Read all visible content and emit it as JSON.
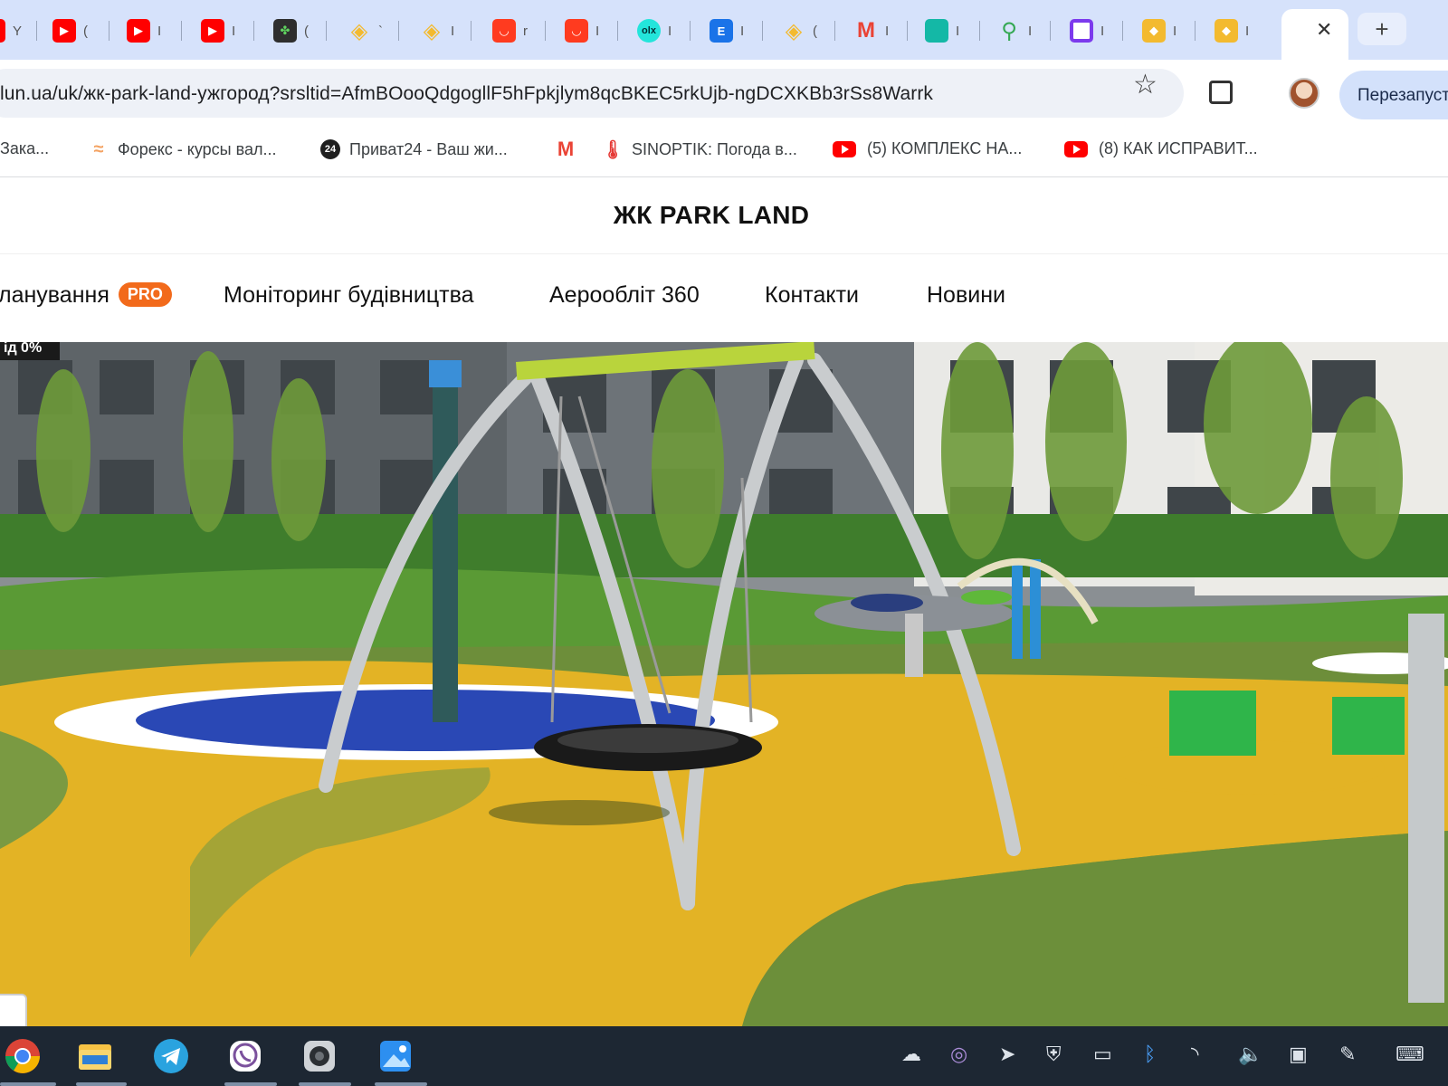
{
  "browser": {
    "tabs": [
      {
        "icon": "youtube-icon",
        "text": "Y",
        "color": "#ff0000"
      },
      {
        "icon": "youtube-icon",
        "text": "(",
        "color": "#ff0000"
      },
      {
        "icon": "youtube-icon",
        "text": "I",
        "color": "#ff0000"
      },
      {
        "icon": "youtube-icon",
        "text": "I",
        "color": "#ff0000"
      },
      {
        "icon": "clover-icon",
        "text": "(",
        "color": "#3a8f3a"
      },
      {
        "icon": "binance-icon",
        "text": "`",
        "color": "#f3ba2f"
      },
      {
        "icon": "binance-icon",
        "text": "I",
        "color": "#f3ba2f"
      },
      {
        "icon": "aliexpress-icon",
        "text": "r",
        "color": "#ff3b1f"
      },
      {
        "icon": "aliexpress-icon",
        "text": "I",
        "color": "#ff3b1f"
      },
      {
        "icon": "olx-icon",
        "text": "I",
        "color": "#002f34"
      },
      {
        "icon": "e-icon",
        "text": "I",
        "color": "#1a73e8"
      },
      {
        "icon": "binance-icon",
        "text": "(",
        "color": "#f3ba2f"
      },
      {
        "icon": "gmail-icon",
        "text": "I",
        "color": "#ea4335"
      },
      {
        "icon": "folder-icon",
        "text": "I",
        "color": "#14b8a6"
      },
      {
        "icon": "maps-icon",
        "text": "I",
        "color": "#34a853"
      },
      {
        "icon": "square-icon",
        "text": "I",
        "color": "#7c3aed"
      },
      {
        "icon": "binance-icon",
        "text": "I",
        "color": "#f3ba2f"
      },
      {
        "icon": "binance-icon",
        "text": "I",
        "color": "#f3ba2f"
      }
    ],
    "active_tab_close": "✕",
    "new_tab": "+",
    "url": "lun.ua/uk/жк-park-land-ужгород?srsltid=AfmBOooQdgogllF5hFpkjlym8qcBKEC5rkUjb-ngDCXKBb3rSs8Warrk",
    "relaunch_label": "Перезапуст",
    "bookmarks": [
      {
        "icon": "doc-icon",
        "label": "Зака..."
      },
      {
        "icon": "forex-icon",
        "label": "Форекс - курсы вал..."
      },
      {
        "icon": "privat24-icon",
        "label": "Приват24 - Ваш жи...",
        "badge": "24"
      },
      {
        "icon": "gmail-icon",
        "label": ""
      },
      {
        "icon": "thermometer-icon",
        "label": "SINOPTIK: Погода в..."
      },
      {
        "icon": "youtube-icon",
        "label": "(5) КОМПЛЕКС НА..."
      },
      {
        "icon": "youtube-icon",
        "label": "(8) КАК ИСПРАВИТ..."
      }
    ]
  },
  "page": {
    "title": "ЖК PARK LAND",
    "nav": [
      {
        "label": "ланування",
        "badge": "PRO"
      },
      {
        "label": "Моніторинг будівництва"
      },
      {
        "label": "Аерообліт 360"
      },
      {
        "label": "Контакти"
      },
      {
        "label": "Новини"
      }
    ],
    "hero_badge": "ід 0%",
    "hero_alt": "playground-photo"
  },
  "taskbar": {
    "apps": [
      "chrome-icon",
      "file-explorer-icon",
      "telegram-icon",
      "viber-icon",
      "camera-icon",
      "photos-icon"
    ],
    "tray": [
      "cloud-icon",
      "viber-icon",
      "telegram-icon",
      "security-icon",
      "battery-icon",
      "bluetooth-icon",
      "network-icon",
      "volume-icon",
      "display-icon",
      "pen-icon",
      "keyboard-icon"
    ]
  },
  "colors": {
    "accent_pro": "#f26a1b",
    "tabstrip": "#d6e2fb",
    "taskbar": "#1d2733"
  }
}
